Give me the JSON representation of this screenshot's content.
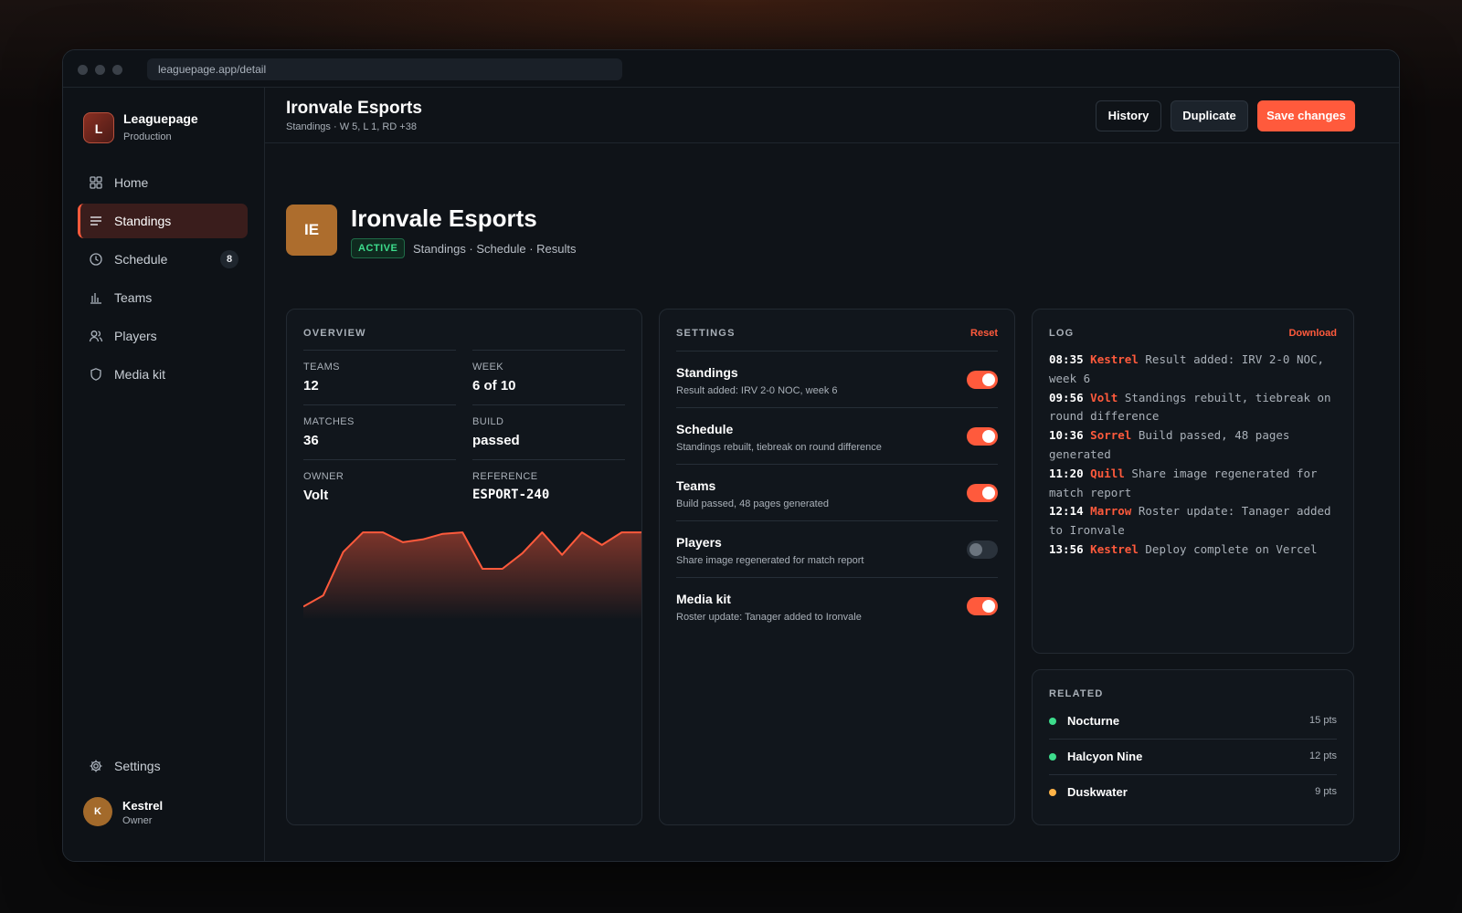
{
  "window": {
    "url": "leaguepage.app/detail"
  },
  "sidebar": {
    "brand": {
      "initial": "L",
      "name": "Leaguepage",
      "env": "Production"
    },
    "items": [
      {
        "label": "Home",
        "icon": "grid-icon"
      },
      {
        "label": "Standings",
        "icon": "list-icon",
        "active": true
      },
      {
        "label": "Schedule",
        "icon": "clock-icon",
        "badge": "8"
      },
      {
        "label": "Teams",
        "icon": "bar-chart-icon"
      },
      {
        "label": "Players",
        "icon": "users-icon"
      },
      {
        "label": "Media kit",
        "icon": "shield-icon"
      }
    ],
    "settings_label": "Settings",
    "user": {
      "initial": "K",
      "name": "Kestrel",
      "role": "Owner"
    }
  },
  "header": {
    "title": "Ironvale Esports",
    "subtitle": "Standings · W 5, L 1, RD +38",
    "history_label": "History",
    "duplicate_label": "Duplicate",
    "save_label": "Save changes"
  },
  "hero": {
    "initials": "IE",
    "title": "Ironvale Esports",
    "status": "ACTIVE",
    "meta": "Standings · Schedule · Results"
  },
  "overview": {
    "heading": "OVERVIEW",
    "fields": [
      {
        "label": "TEAMS",
        "value": "12"
      },
      {
        "label": "WEEK",
        "value": "6 of 10"
      },
      {
        "label": "MATCHES",
        "value": "36"
      },
      {
        "label": "BUILD",
        "value": "passed"
      },
      {
        "label": "OWNER",
        "value": "Volt"
      },
      {
        "label": "REFERENCE",
        "value": "ESPORT-240"
      }
    ],
    "sparkline": [
      3,
      11,
      42,
      56,
      56,
      49,
      51,
      55,
      56,
      30,
      30,
      41,
      56,
      40,
      56,
      47,
      56,
      56,
      55
    ]
  },
  "settings": {
    "heading": "SETTINGS",
    "reset_label": "Reset",
    "rows": [
      {
        "title": "Standings",
        "desc": "Result added: IRV 2-0 NOC, week 6",
        "on": true
      },
      {
        "title": "Schedule",
        "desc": "Standings rebuilt, tiebreak on round difference",
        "on": true
      },
      {
        "title": "Teams",
        "desc": "Build passed, 48 pages generated",
        "on": true
      },
      {
        "title": "Players",
        "desc": "Share image regenerated for match report",
        "on": false
      },
      {
        "title": "Media kit",
        "desc": "Roster update: Tanager added to Ironvale",
        "on": true
      }
    ]
  },
  "log": {
    "heading": "LOG",
    "download_label": "Download",
    "entries": [
      {
        "time": "08:35",
        "who": "Kestrel",
        "text": "Result added: IRV 2-0 NOC, week 6"
      },
      {
        "time": "09:56",
        "who": "Volt",
        "text": "Standings rebuilt, tiebreak on round difference"
      },
      {
        "time": "10:36",
        "who": "Sorrel",
        "text": "Build passed, 48 pages generated"
      },
      {
        "time": "11:20",
        "who": "Quill",
        "text": "Share image regenerated for match report"
      },
      {
        "time": "12:14",
        "who": "Marrow",
        "text": "Roster update: Tanager added to Ironvale"
      },
      {
        "time": "13:56",
        "who": "Kestrel",
        "text": "Deploy complete on Vercel"
      }
    ]
  },
  "related": {
    "heading": "RELATED",
    "items": [
      {
        "name": "Nocturne",
        "pts": "15 pts",
        "color": "#3ddc8c"
      },
      {
        "name": "Halcyon Nine",
        "pts": "12 pts",
        "color": "#3ddc8c"
      },
      {
        "name": "Duskwater",
        "pts": "9 pts",
        "color": "#ffb347"
      }
    ]
  },
  "colors": {
    "accent": "#ff5a3c",
    "success": "#3ddc8c",
    "warning": "#ffb347"
  }
}
